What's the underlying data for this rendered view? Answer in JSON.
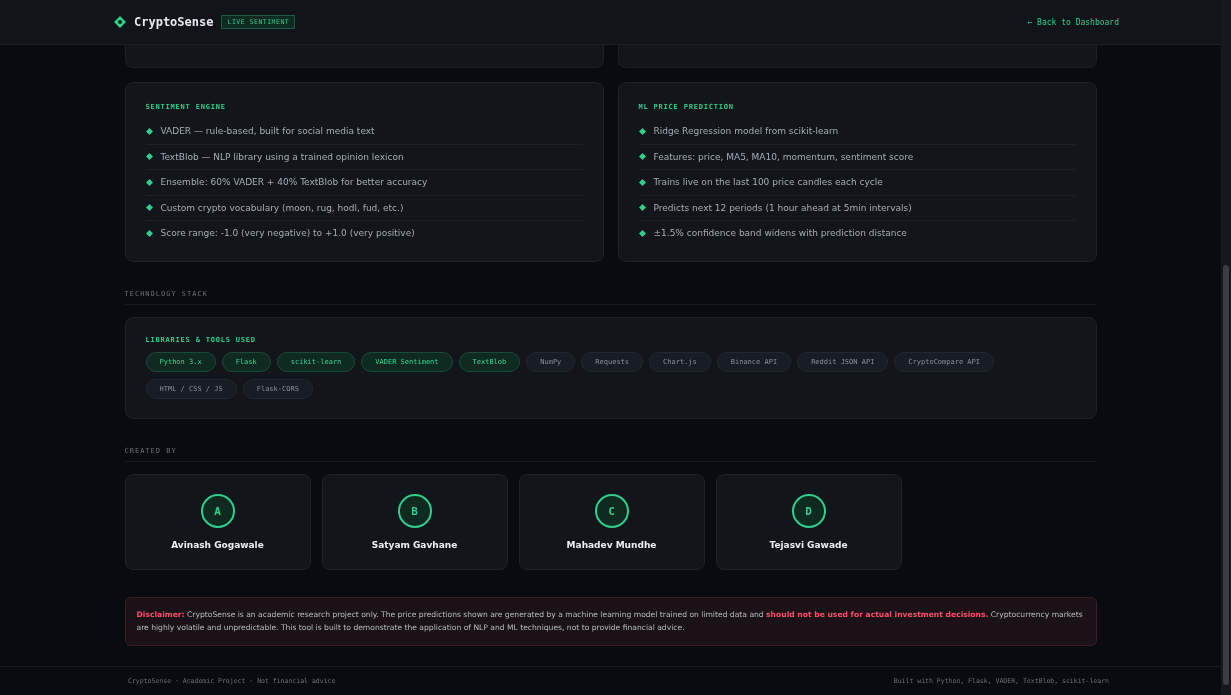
{
  "header": {
    "brand": "CryptoSense",
    "badge": "LIVE SENTIMENT",
    "back_link": "← Back to Dashboard"
  },
  "feature_cards": [
    {
      "title": "SENTIMENT ENGINE",
      "items": [
        "VADER — rule-based, built for social media text",
        "TextBlob — NLP library using a trained opinion lexicon",
        "Ensemble: 60% VADER + 40% TextBlob for better accuracy",
        "Custom crypto vocabulary (moon, rug, hodl, fud, etc.)",
        "Score range: -1.0 (very negative) to +1.0 (very positive)"
      ]
    },
    {
      "title": "ML PRICE PREDICTION",
      "items": [
        "Ridge Regression model from scikit-learn",
        "Features: price, MA5, MA10, momentum, sentiment score",
        "Trains live on the last 100 price candles each cycle",
        "Predicts next 12 periods (1 hour ahead at 5min intervals)",
        "±1.5% confidence band widens with prediction distance"
      ]
    }
  ],
  "tech_section": {
    "heading": "TECHNOLOGY STACK",
    "card_title": "LIBRARIES & TOOLS USED",
    "tags": [
      {
        "label": "Python 3.x",
        "highlighted": true
      },
      {
        "label": "Flask",
        "highlighted": true
      },
      {
        "label": "scikit-learn",
        "highlighted": true
      },
      {
        "label": "VADER Sentiment",
        "highlighted": true
      },
      {
        "label": "TextBlob",
        "highlighted": true
      },
      {
        "label": "NumPy",
        "highlighted": false
      },
      {
        "label": "Requests",
        "highlighted": false
      },
      {
        "label": "Chart.js",
        "highlighted": false
      },
      {
        "label": "Binance API",
        "highlighted": false
      },
      {
        "label": "Reddit JSON API",
        "highlighted": false
      },
      {
        "label": "CryptoCompare API",
        "highlighted": false
      },
      {
        "label": "HTML / CSS / JS",
        "highlighted": false
      },
      {
        "label": "Flask-CORS",
        "highlighted": false
      }
    ]
  },
  "creators_section": {
    "heading": "CREATED BY",
    "creators": [
      {
        "initial": "A",
        "name": "Avinash Gogawale"
      },
      {
        "initial": "B",
        "name": "Satyam Gavhane"
      },
      {
        "initial": "C",
        "name": "Mahadev Mundhe"
      },
      {
        "initial": "D",
        "name": "Tejasvi Gawade"
      }
    ]
  },
  "disclaimer": "**Disclaimer:** CryptoSense is an academic research project only. The price predictions shown are generated by a machine learning model trained on limited data and **should not be used for actual investment decisions.** Cryptocurrency markets are highly volatile and unpredictable. This tool is built to demonstrate the application of NLP and ML techniques, not to provide financial advice.",
  "footer": {
    "left": "CryptoSense · Academic Project · Not financial advice",
    "right": "Built with Python, Flask, VADER, TextBlob, scikit-learn"
  }
}
